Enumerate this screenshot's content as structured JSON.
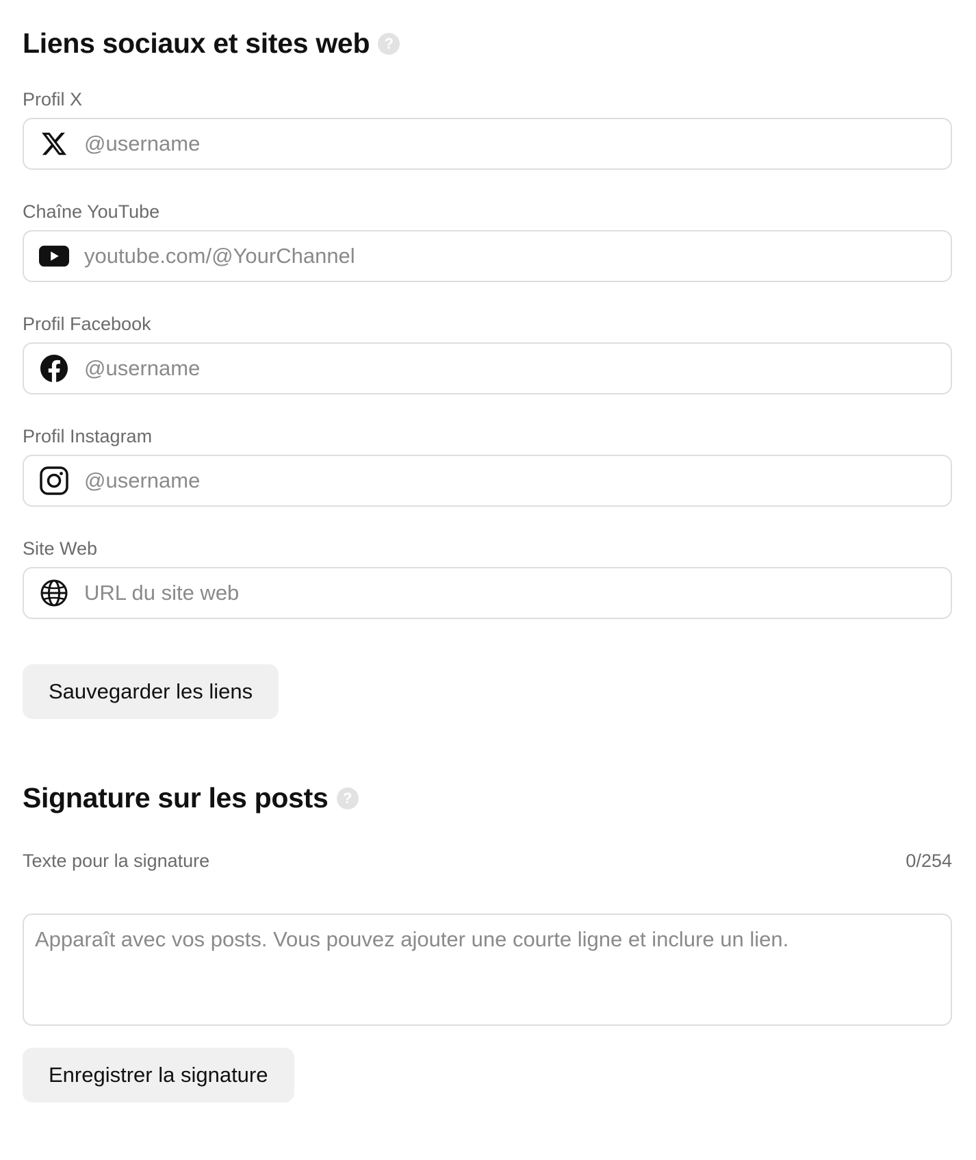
{
  "social_section": {
    "title": "Liens sociaux et sites web",
    "help_icon_glyph": "?",
    "fields": [
      {
        "label": "Profil X",
        "placeholder": "@username",
        "icon": "x-logo-icon",
        "value": ""
      },
      {
        "label": "Chaîne YouTube",
        "placeholder": "youtube.com/@YourChannel",
        "icon": "youtube-icon",
        "value": ""
      },
      {
        "label": "Profil Facebook",
        "placeholder": "@username",
        "icon": "facebook-icon",
        "value": ""
      },
      {
        "label": "Profil Instagram",
        "placeholder": "@username",
        "icon": "instagram-icon",
        "value": ""
      },
      {
        "label": "Site Web",
        "placeholder": "URL du site web",
        "icon": "globe-icon",
        "value": ""
      }
    ],
    "save_button_label": "Sauvegarder les liens"
  },
  "signature_section": {
    "title": "Signature sur les posts",
    "help_icon_glyph": "?",
    "field_label": "Texte pour la signature",
    "counter": "0/254",
    "placeholder": "Apparaît avec vos posts. Vous pouvez ajouter une courte ligne et inclure un lien.",
    "value": "",
    "save_button_label": "Enregistrer la signature"
  },
  "colors": {
    "text_primary": "#111111",
    "text_muted": "#6b6b6b",
    "placeholder": "#8a8a8a",
    "border": "#dedede",
    "button_bg": "#f0f0f0",
    "help_icon_bg": "#e2e2e2"
  }
}
